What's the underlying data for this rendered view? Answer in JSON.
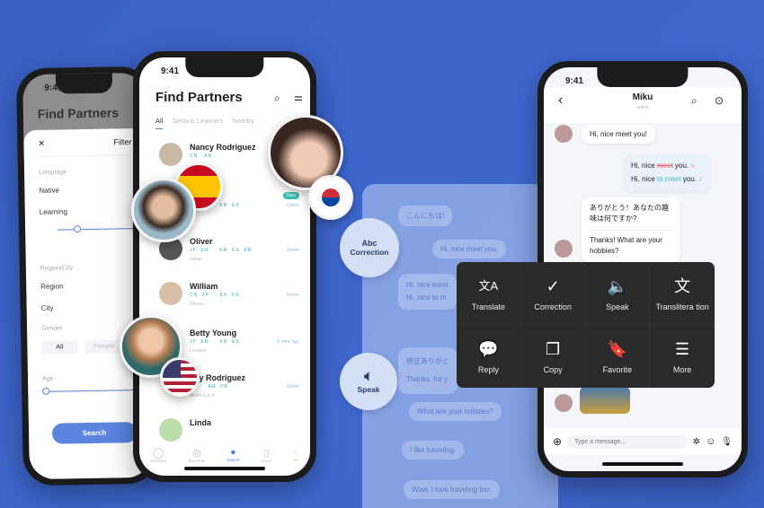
{
  "filter_phone": {
    "time": "9:41",
    "title": "Find Partners",
    "sheet_title": "Filter",
    "sections": {
      "language": "Language",
      "region": "Region/City",
      "gender": "Gender",
      "age": "Age"
    },
    "items": {
      "native": "Native",
      "learning": "Learning",
      "region": "Region",
      "city": "City"
    },
    "gender_options": [
      "All",
      "Female"
    ],
    "search_label": "Search"
  },
  "partners_phone": {
    "time": "9:41",
    "title": "Find Partners",
    "tabs": [
      "All",
      "Serious Learners",
      "Nearby"
    ],
    "rows": [
      {
        "name": "Nancy Rodriguez",
        "langs": "CN   AR",
        "city": "",
        "status": ""
      },
      {
        "name": "",
        "langs": "JP  EN     KR  ES",
        "city": "",
        "status": "Online"
      },
      {
        "name": "Oliver",
        "langs": "JP  EN     KR  ES  FR",
        "city": "Dallas",
        "status": "Online"
      },
      {
        "name": "William",
        "langs": "CN  JP     ES  FR",
        "city": "Ottawa",
        "status": "Online"
      },
      {
        "name": "Betty Young",
        "langs": "JP  EN     KR  ES",
        "city": "Location",
        "status": "5 mins ago"
      },
      {
        "name": "ncy Rodriguez",
        "langs": "EN     AR  FR",
        "city": "Miami,U.S.A",
        "status": "Online"
      },
      {
        "name": "Linda",
        "langs": "",
        "city": "",
        "status": ""
      }
    ],
    "new_badge": "New",
    "nav": [
      {
        "label": "Moments",
        "icon": "chat-icon"
      },
      {
        "label": "Moments",
        "icon": "planet-icon"
      },
      {
        "label": "Search",
        "icon": "search-icon"
      },
      {
        "label": "Learn",
        "icon": "book-icon"
      },
      {
        "label": "Me",
        "icon": "profile-icon"
      }
    ]
  },
  "features": {
    "correction": "Correction",
    "correction_icon": "Abc",
    "speak": "Speak"
  },
  "faded_chat": {
    "messages": [
      "こんにちは!",
      "Hi, nice meet you.",
      "Hi, nice meet",
      "Hi, nice to m",
      "修正ありがと",
      "Thanks. for y",
      "What are your hobbies?",
      "I like traveling.",
      "Wow, I love traveling too."
    ]
  },
  "chat_phone": {
    "time": "9:41",
    "contact": "Miku",
    "status": "online",
    "messages": {
      "m1": "Hi, nice meet you!",
      "wrong_pre": "Hi, nice ",
      "wrong_word": "meet",
      "wrong_post": " you.",
      "right_pre": "Hi, nice ",
      "right_word": "to meet",
      "right_post": " you.",
      "jp": "ありがとう！あなたの趣味は何ですか?",
      "en": "Thanks! What are your hobbies?"
    },
    "input_placeholder": "Type a message..."
  },
  "context_menu": [
    {
      "label": "Translate",
      "icon": "translate-icon",
      "glyph": "文A"
    },
    {
      "label": "Correction",
      "icon": "correction-icon",
      "glyph": "✓"
    },
    {
      "label": "Speak",
      "icon": "speaker-icon",
      "glyph": "🔈"
    },
    {
      "label": "Translitera tion",
      "icon": "transliteration-icon",
      "glyph": "文"
    },
    {
      "label": "Reply",
      "icon": "reply-icon",
      "glyph": "💬"
    },
    {
      "label": "Copy",
      "icon": "copy-icon",
      "glyph": "❐"
    },
    {
      "label": "Favorite",
      "icon": "bookmark-icon",
      "glyph": "🔖"
    },
    {
      "label": "More",
      "icon": "list-icon",
      "glyph": "☰"
    }
  ],
  "colors": {
    "background": "#3d63c8",
    "accent": "#4a7ae0",
    "error": "#e06060",
    "correct": "#3cc0c0",
    "menu": "#2a2a2b"
  }
}
